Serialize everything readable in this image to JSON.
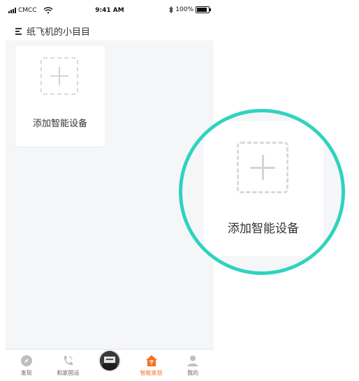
{
  "status_bar": {
    "carrier": "CMCC",
    "time": "9:41 AM",
    "battery_text": "100%",
    "battery_level": 1.0,
    "icons": [
      "signal-icon",
      "wifi-icon",
      "bluetooth-icon",
      "battery-icon"
    ]
  },
  "header": {
    "title": "纸飞机的小目目",
    "menu_icon": "menu-icon"
  },
  "device_card": {
    "add_label": "添加智能设备",
    "icon": "add-plus-icon"
  },
  "zoom_callout": {
    "add_label": "添加智能设备"
  },
  "tabbar": {
    "tabs": [
      {
        "label": "发现",
        "icon": "compass-icon",
        "active": false
      },
      {
        "label": "和家固话",
        "icon": "phone-icon",
        "active": false
      },
      {
        "label": "",
        "icon": "avatar",
        "active": false
      },
      {
        "label": "智能家居",
        "icon": "smart-home-icon",
        "active": true
      },
      {
        "label": "我的",
        "icon": "user-icon",
        "active": false
      }
    ]
  },
  "colors": {
    "accent": "#f37021",
    "highlight_ring": "#2fd3bf",
    "background": "#f5f6f8"
  }
}
